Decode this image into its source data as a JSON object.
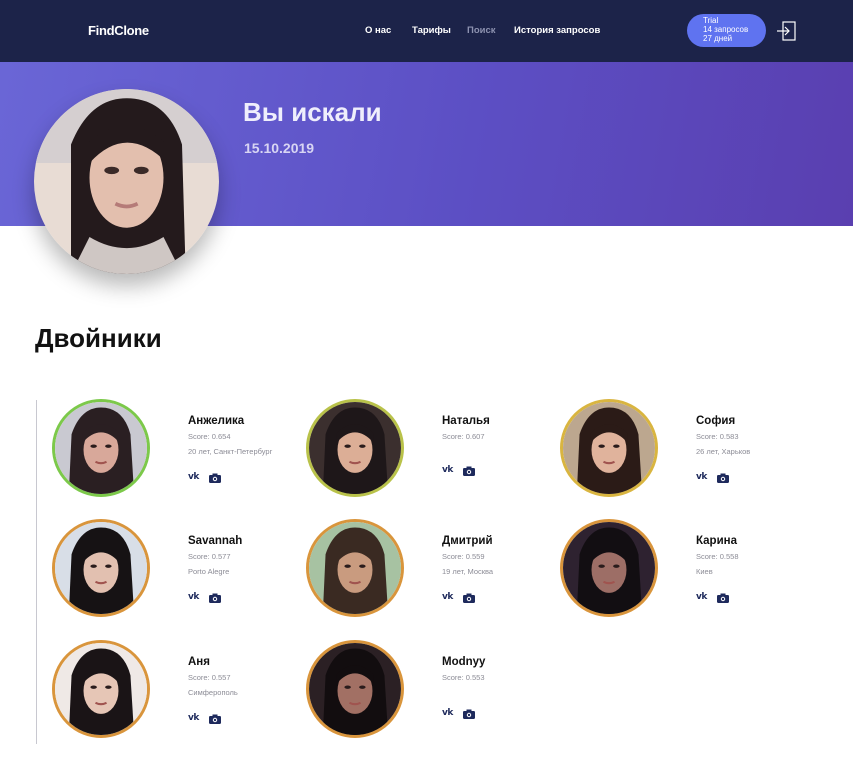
{
  "header": {
    "logo": "FindClone",
    "nav": [
      {
        "label": "О нас",
        "active": true
      },
      {
        "label": "Тарифы",
        "active": true
      },
      {
        "label": "Поиск",
        "active": false
      },
      {
        "label": "История запросов",
        "active": true
      }
    ],
    "trial": {
      "plan": "Trial",
      "requests": "14 запросов",
      "days": "27 дней"
    },
    "logout_icon": "logout-icon"
  },
  "hero": {
    "title": "Вы искали",
    "date": "15.10.2019"
  },
  "section": {
    "title": "Двойники"
  },
  "colors": {
    "header_bg": "#1c2349",
    "hero_gradient_start": "#6a66d6",
    "hero_gradient_end": "#5a3fb0",
    "trial_bg": "#5f73f0",
    "ring_green": "#7cc94a",
    "ring_yellowgreen": "#b9c24a",
    "ring_yellow": "#d9b540",
    "ring_orange": "#d9953c"
  },
  "results": [
    {
      "name": "Анжелика",
      "score": "Score: 0.654",
      "location": "20 лет, Санкт-Петербург",
      "ring": "green"
    },
    {
      "name": "Наталья",
      "score": "Score: 0.607",
      "location": "",
      "ring": "yellowgreen"
    },
    {
      "name": "София",
      "score": "Score: 0.583",
      "location": "26 лет, Харьков",
      "ring": "yellow"
    },
    {
      "name": "Savannah",
      "score": "Score: 0.577",
      "location": "Porto Alegre",
      "ring": "orange"
    },
    {
      "name": "Дмитрий",
      "score": "Score: 0.559",
      "location": "19 лет, Москва",
      "ring": "orange"
    },
    {
      "name": "Карина",
      "score": "Score: 0.558",
      "location": "Киев",
      "ring": "orange"
    },
    {
      "name": "Аня",
      "score": "Score: 0.557",
      "location": "Симферополь",
      "ring": "orange"
    },
    {
      "name": "Modnyy",
      "score": "Score: 0.553",
      "location": "",
      "ring": "orange"
    }
  ],
  "actions": {
    "vk_label": "vk",
    "vk_icon": "vk-icon",
    "photo_icon": "camera-icon"
  }
}
